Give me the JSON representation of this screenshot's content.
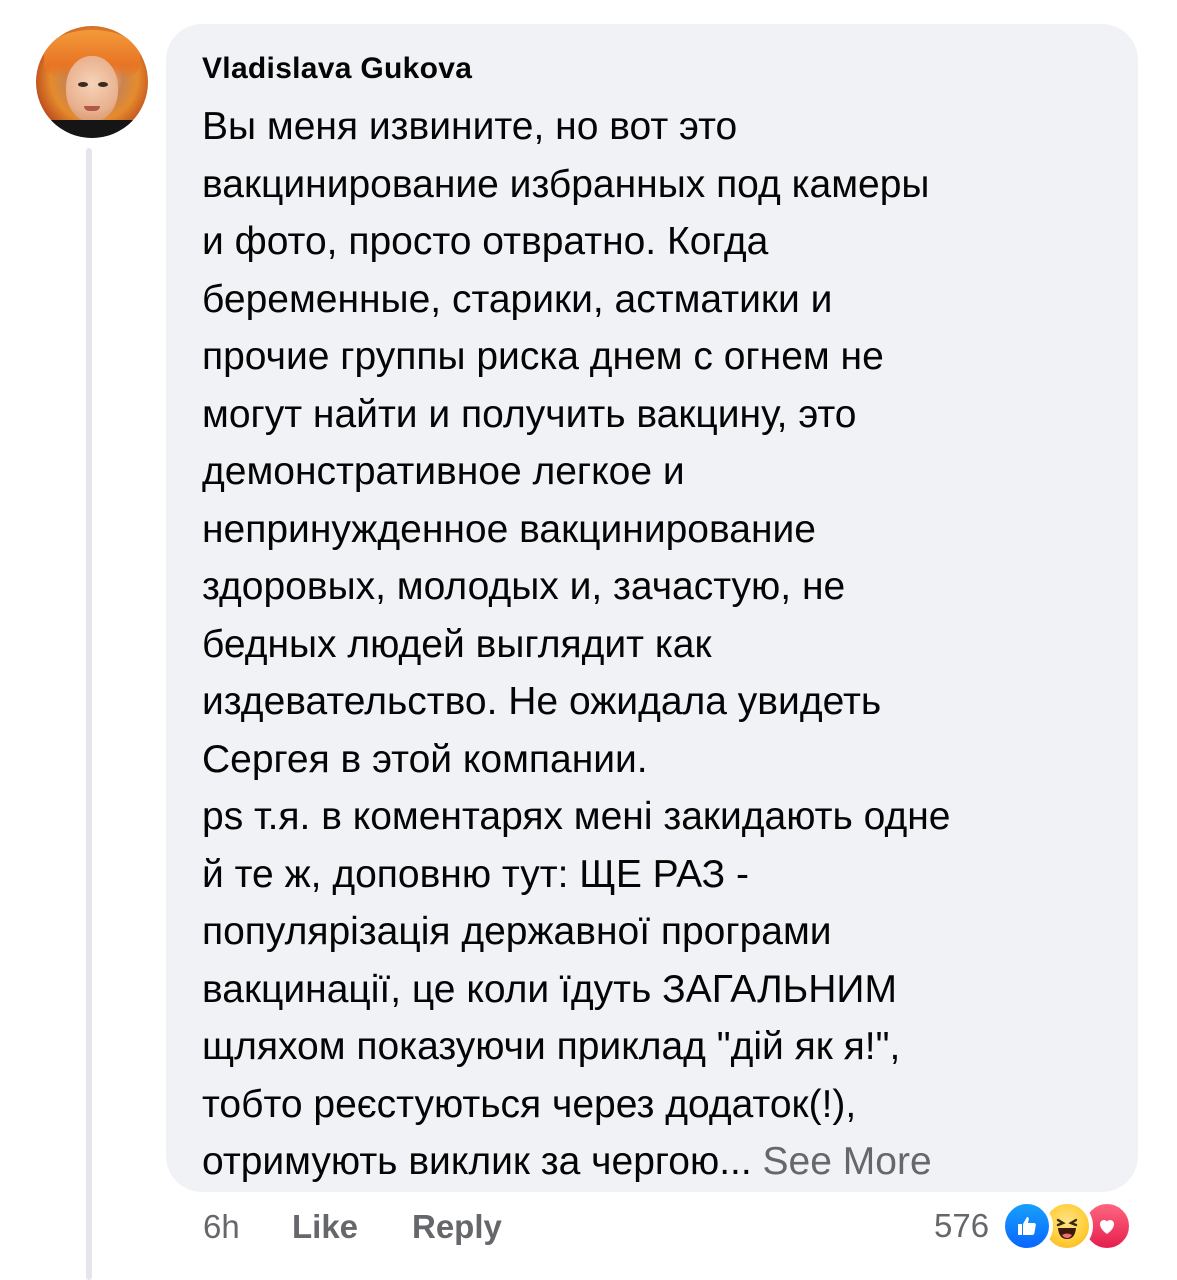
{
  "comment": {
    "author": "Vladislava Gukova",
    "body_lines": [
      "Вы меня извините, но вот это",
      "вакцинирование избранных под камеры",
      "и фото, просто отвратно. Когда",
      "беременные, старики, астматики и",
      "прочие группы риска днем с огнем не",
      "могут найти и получить вакцину, это",
      "демонстративное легкое и",
      "непринужденное вакцинирование",
      "здоровых, молодых и, зачастую, не",
      "бедных людей выглядит как",
      "издевательство. Не ожидала увидеть",
      "Сергея в этой компании.",
      "ps т.я. в коментарях мені закидають одне",
      "й те ж, доповню тут: ЩЕ РАЗ -",
      "популярізація державної програми",
      "вакцинації, це коли їдуть ЗАГАЛЬНИМ",
      "щляхом показуючи приклад \"дій як я!\",",
      "тобто реєстуються через додаток(!),",
      "отримують виклик за чергою..."
    ],
    "see_more_label": "See More",
    "time": "6h",
    "like_label": "Like",
    "reply_label": "Reply",
    "reaction_count": "576",
    "reactions": [
      "like-icon",
      "haha-icon",
      "love-icon"
    ]
  },
  "colors": {
    "bubble": "#f0f2f5",
    "secondary_text": "#65676b",
    "like_blue": "#0866ff",
    "love_red": "#e61e4d",
    "haha_yellow": "#ffcc33"
  }
}
